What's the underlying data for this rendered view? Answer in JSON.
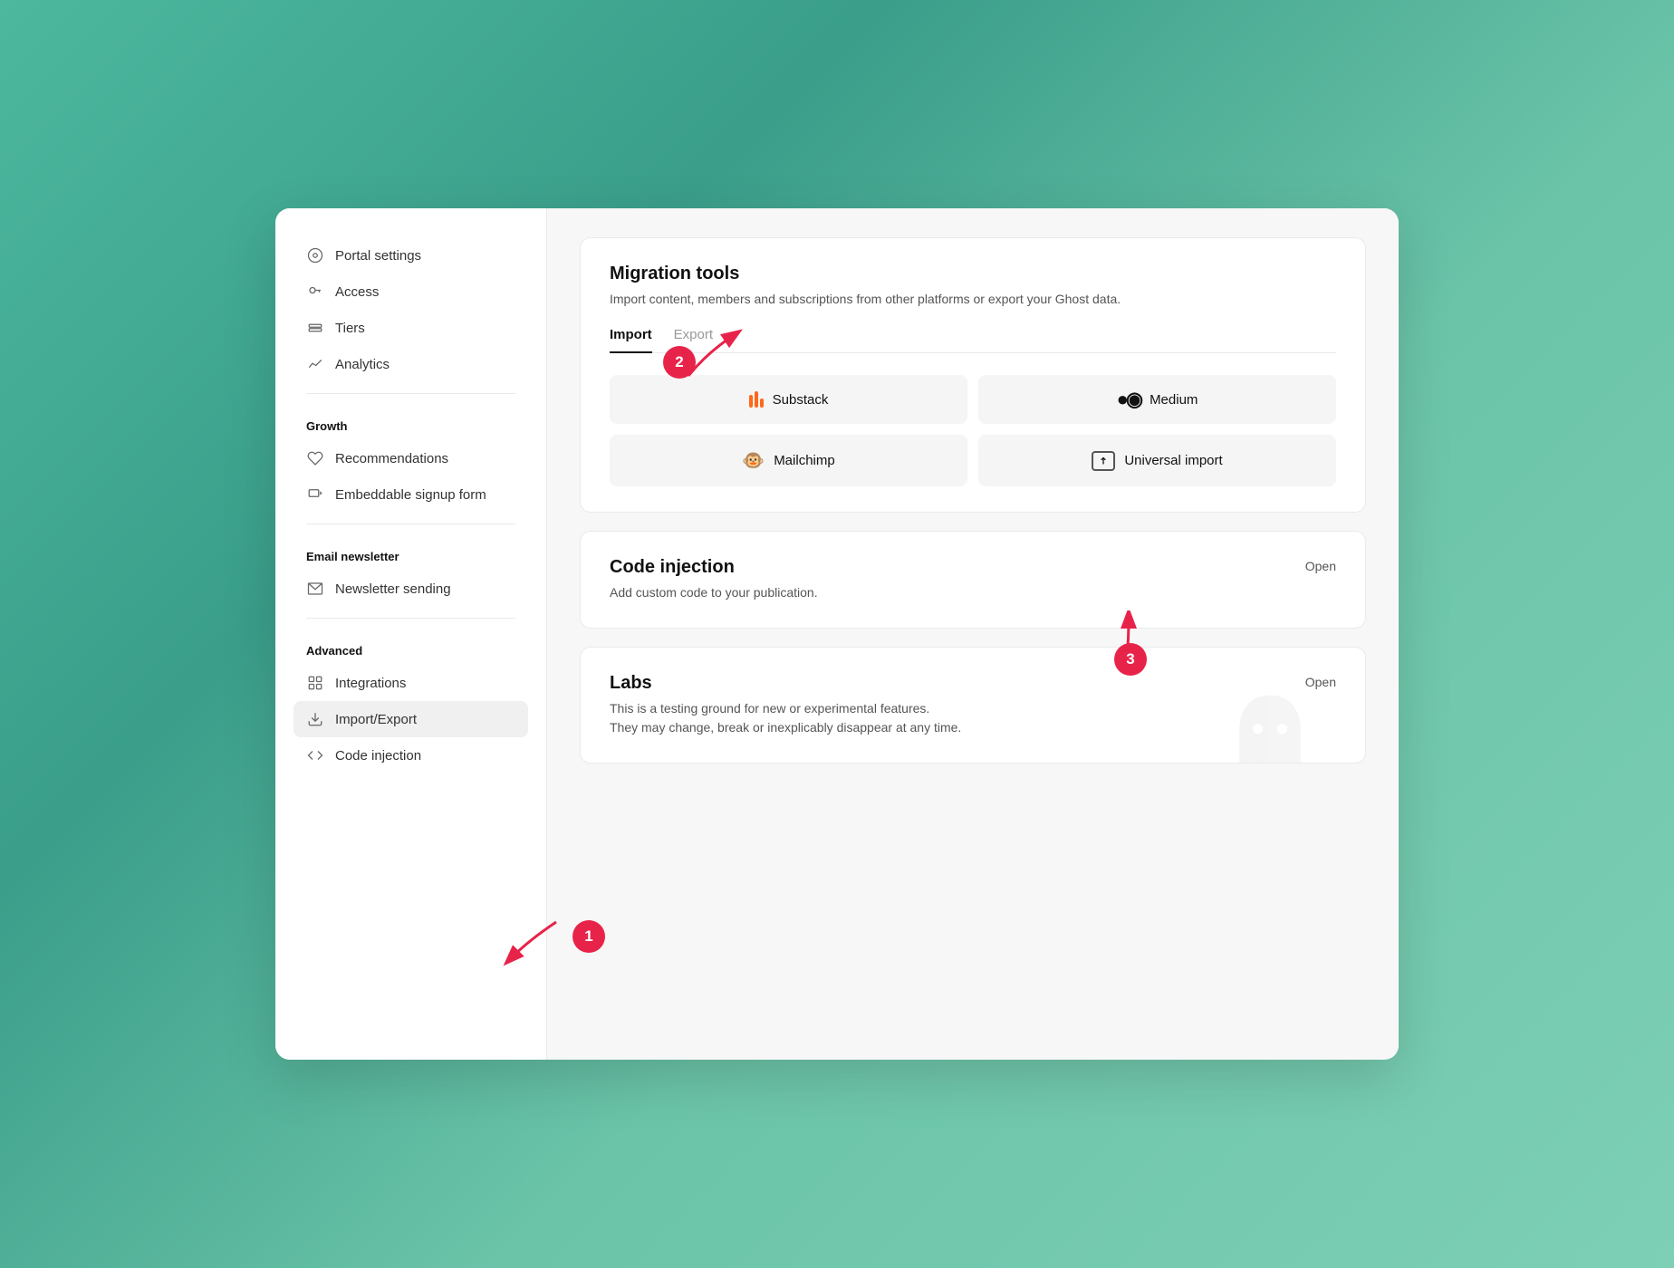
{
  "sidebar": {
    "items": [
      {
        "id": "portal-settings",
        "label": "Portal settings",
        "icon": "gear-circle"
      },
      {
        "id": "access",
        "label": "Access",
        "icon": "key"
      },
      {
        "id": "tiers",
        "label": "Tiers",
        "icon": "layers"
      },
      {
        "id": "analytics",
        "label": "Analytics",
        "icon": "chart"
      }
    ],
    "sections": [
      {
        "label": "Growth",
        "items": [
          {
            "id": "recommendations",
            "label": "Recommendations",
            "icon": "heart"
          },
          {
            "id": "embeddable-signup",
            "label": "Embeddable signup form",
            "icon": "signup"
          }
        ]
      },
      {
        "label": "Email newsletter",
        "items": [
          {
            "id": "newsletter-sending",
            "label": "Newsletter sending",
            "icon": "envelope"
          }
        ]
      },
      {
        "label": "Advanced",
        "items": [
          {
            "id": "integrations",
            "label": "Integrations",
            "icon": "grid"
          },
          {
            "id": "import-export",
            "label": "Import/Export",
            "icon": "import",
            "active": true
          },
          {
            "id": "code-injection",
            "label": "Code injection",
            "icon": "code"
          }
        ]
      }
    ]
  },
  "main": {
    "migration_tools": {
      "title": "Migration tools",
      "description": "Import content, members and subscriptions from other platforms or export your Ghost data.",
      "tabs": [
        {
          "id": "import",
          "label": "Import",
          "active": true
        },
        {
          "id": "export",
          "label": "Export",
          "active": false
        }
      ],
      "import_buttons": [
        {
          "id": "substack",
          "label": "Substack",
          "icon": "substack"
        },
        {
          "id": "medium",
          "label": "Medium",
          "icon": "medium"
        },
        {
          "id": "mailchimp",
          "label": "Mailchimp",
          "icon": "mailchimp"
        },
        {
          "id": "universal-import",
          "label": "Universal import",
          "icon": "upload"
        }
      ]
    },
    "code_injection": {
      "title": "Code injection",
      "description": "Add custom code to your publication.",
      "action_label": "Open"
    },
    "labs": {
      "title": "Labs",
      "description": "This is a testing ground for new or experimental features.\nThey may change, break or inexplicably disappear at any time.",
      "action_label": "Open"
    }
  },
  "annotations": [
    {
      "number": "1",
      "description": "Arrow pointing to Import/Export sidebar item"
    },
    {
      "number": "2",
      "description": "Arrow pointing to Migration tools card"
    },
    {
      "number": "3",
      "description": "Arrow pointing to Universal import button"
    }
  ]
}
